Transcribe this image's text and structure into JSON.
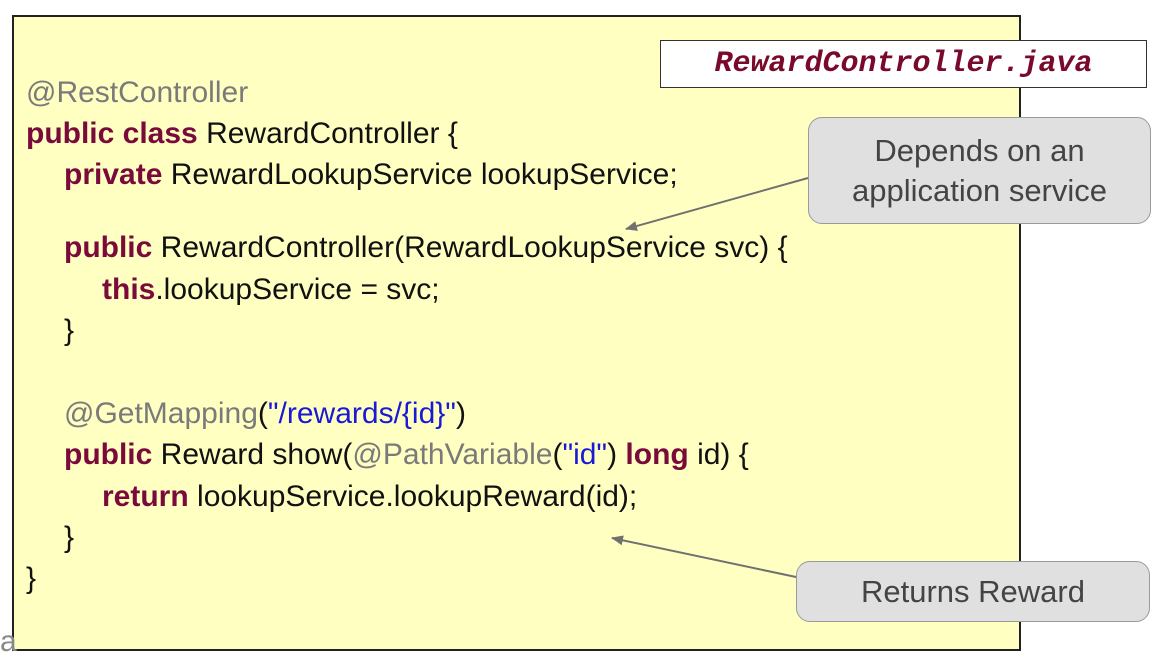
{
  "file_tab": {
    "label": "RewardController.java"
  },
  "code": {
    "line1": {
      "annotation": "@RestController"
    },
    "line2": {
      "kw": "public class",
      "text": " RewardController {"
    },
    "line3": {
      "kw": "private",
      "text": " RewardLookupService lookupService;"
    },
    "line4": {
      "kw": "public",
      "text": " RewardController(RewardLookupService svc) {"
    },
    "line5": {
      "kw": "this",
      "text": ".lookupService = svc;"
    },
    "line6": {
      "text": "}"
    },
    "line7": {
      "annotation": "@GetMapping",
      "open": "(",
      "string": "\"/rewards/{id}\"",
      "close": ")"
    },
    "line8": {
      "kw": "public",
      "text1": " Reward show(",
      "annotation": "@PathVariable",
      "open": "(",
      "string": "\"id\"",
      "close": ") ",
      "kw2": "long",
      "text2": " id) {"
    },
    "line9": {
      "kw": "return",
      "text": " lookupService.lookupReward(id);"
    },
    "line10": {
      "text": "}"
    },
    "line11": {
      "text": "}"
    }
  },
  "callouts": {
    "depends": {
      "line1": "Depends on an",
      "line2": "application service"
    },
    "returns": {
      "text": "Returns Reward"
    }
  },
  "edge_glyph": "a",
  "colors": {
    "background": "#ffffc2",
    "keyword": "#7a0a3c",
    "annotation": "#7a7a7a",
    "string": "#1a1ad6",
    "callout_fill": "#e0e0e0",
    "file_tab_text": "#7a0a2c"
  }
}
